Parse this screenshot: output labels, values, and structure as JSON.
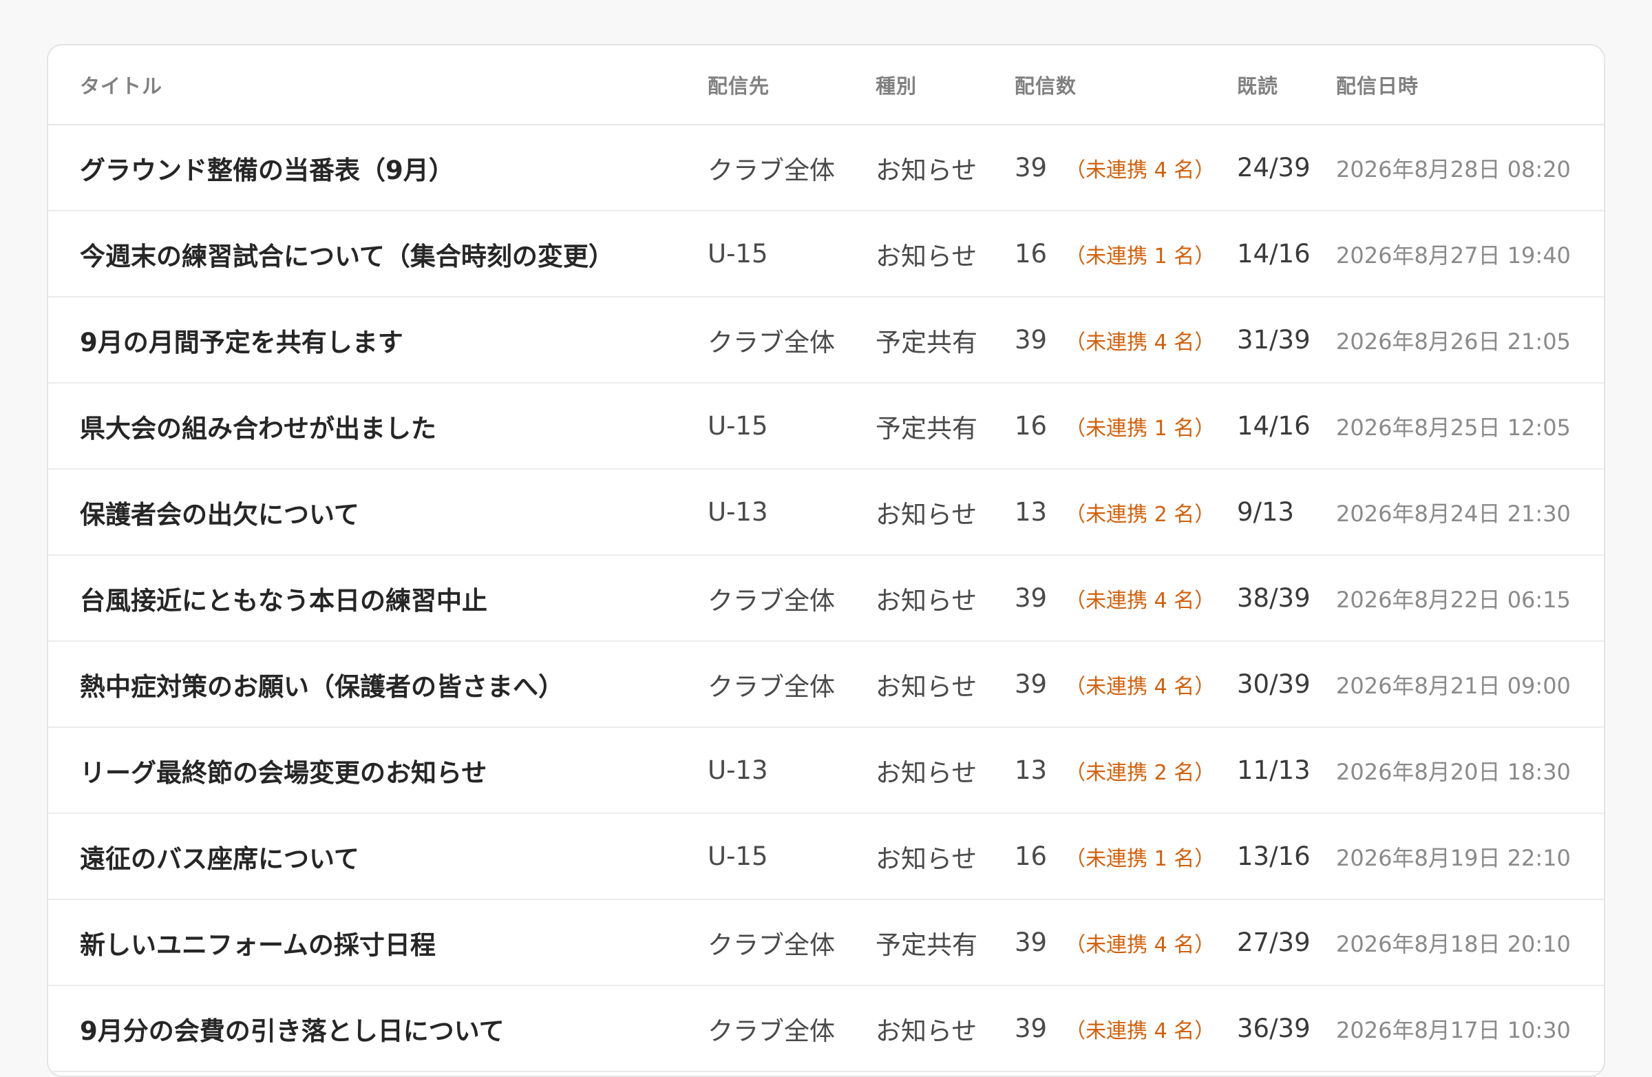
{
  "table": {
    "headers": {
      "title": "タイトル",
      "target": "配信先",
      "type": "種別",
      "count": "配信数",
      "read": "既読",
      "date": "配信日時"
    },
    "rows": [
      {
        "title": "グラウンド整備の当番表（9月）",
        "target": "クラブ全体",
        "type": "お知らせ",
        "count": "39",
        "unlinked": "（未連携 4 名）",
        "read": "24/39",
        "date": "2026年8月28日 08:20"
      },
      {
        "title": "今週末の練習試合について（集合時刻の変更）",
        "target": "U-15",
        "type": "お知らせ",
        "count": "16",
        "unlinked": "（未連携 1 名）",
        "read": "14/16",
        "date": "2026年8月27日 19:40"
      },
      {
        "title": "9月の月間予定を共有します",
        "target": "クラブ全体",
        "type": "予定共有",
        "count": "39",
        "unlinked": "（未連携 4 名）",
        "read": "31/39",
        "date": "2026年8月26日 21:05"
      },
      {
        "title": "県大会の組み合わせが出ました",
        "target": "U-15",
        "type": "予定共有",
        "count": "16",
        "unlinked": "（未連携 1 名）",
        "read": "14/16",
        "date": "2026年8月25日 12:05"
      },
      {
        "title": "保護者会の出欠について",
        "target": "U-13",
        "type": "お知らせ",
        "count": "13",
        "unlinked": "（未連携 2 名）",
        "read": "9/13",
        "date": "2026年8月24日 21:30"
      },
      {
        "title": "台風接近にともなう本日の練習中止",
        "target": "クラブ全体",
        "type": "お知らせ",
        "count": "39",
        "unlinked": "（未連携 4 名）",
        "read": "38/39",
        "date": "2026年8月22日 06:15"
      },
      {
        "title": "熱中症対策のお願い（保護者の皆さまへ）",
        "target": "クラブ全体",
        "type": "お知らせ",
        "count": "39",
        "unlinked": "（未連携 4 名）",
        "read": "30/39",
        "date": "2026年8月21日 09:00"
      },
      {
        "title": "リーグ最終節の会場変更のお知らせ",
        "target": "U-13",
        "type": "お知らせ",
        "count": "13",
        "unlinked": "（未連携 2 名）",
        "read": "11/13",
        "date": "2026年8月20日 18:30"
      },
      {
        "title": "遠征のバス座席について",
        "target": "U-15",
        "type": "お知らせ",
        "count": "16",
        "unlinked": "（未連携 1 名）",
        "read": "13/16",
        "date": "2026年8月19日 22:10"
      },
      {
        "title": "新しいユニフォームの採寸日程",
        "target": "クラブ全体",
        "type": "予定共有",
        "count": "39",
        "unlinked": "（未連携 4 名）",
        "read": "27/39",
        "date": "2026年8月18日 20:10"
      },
      {
        "title": "9月分の会費の引き落とし日について",
        "target": "クラブ全体",
        "type": "お知らせ",
        "count": "39",
        "unlinked": "（未連携 4 名）",
        "read": "36/39",
        "date": "2026年8月17日 10:30"
      }
    ]
  }
}
